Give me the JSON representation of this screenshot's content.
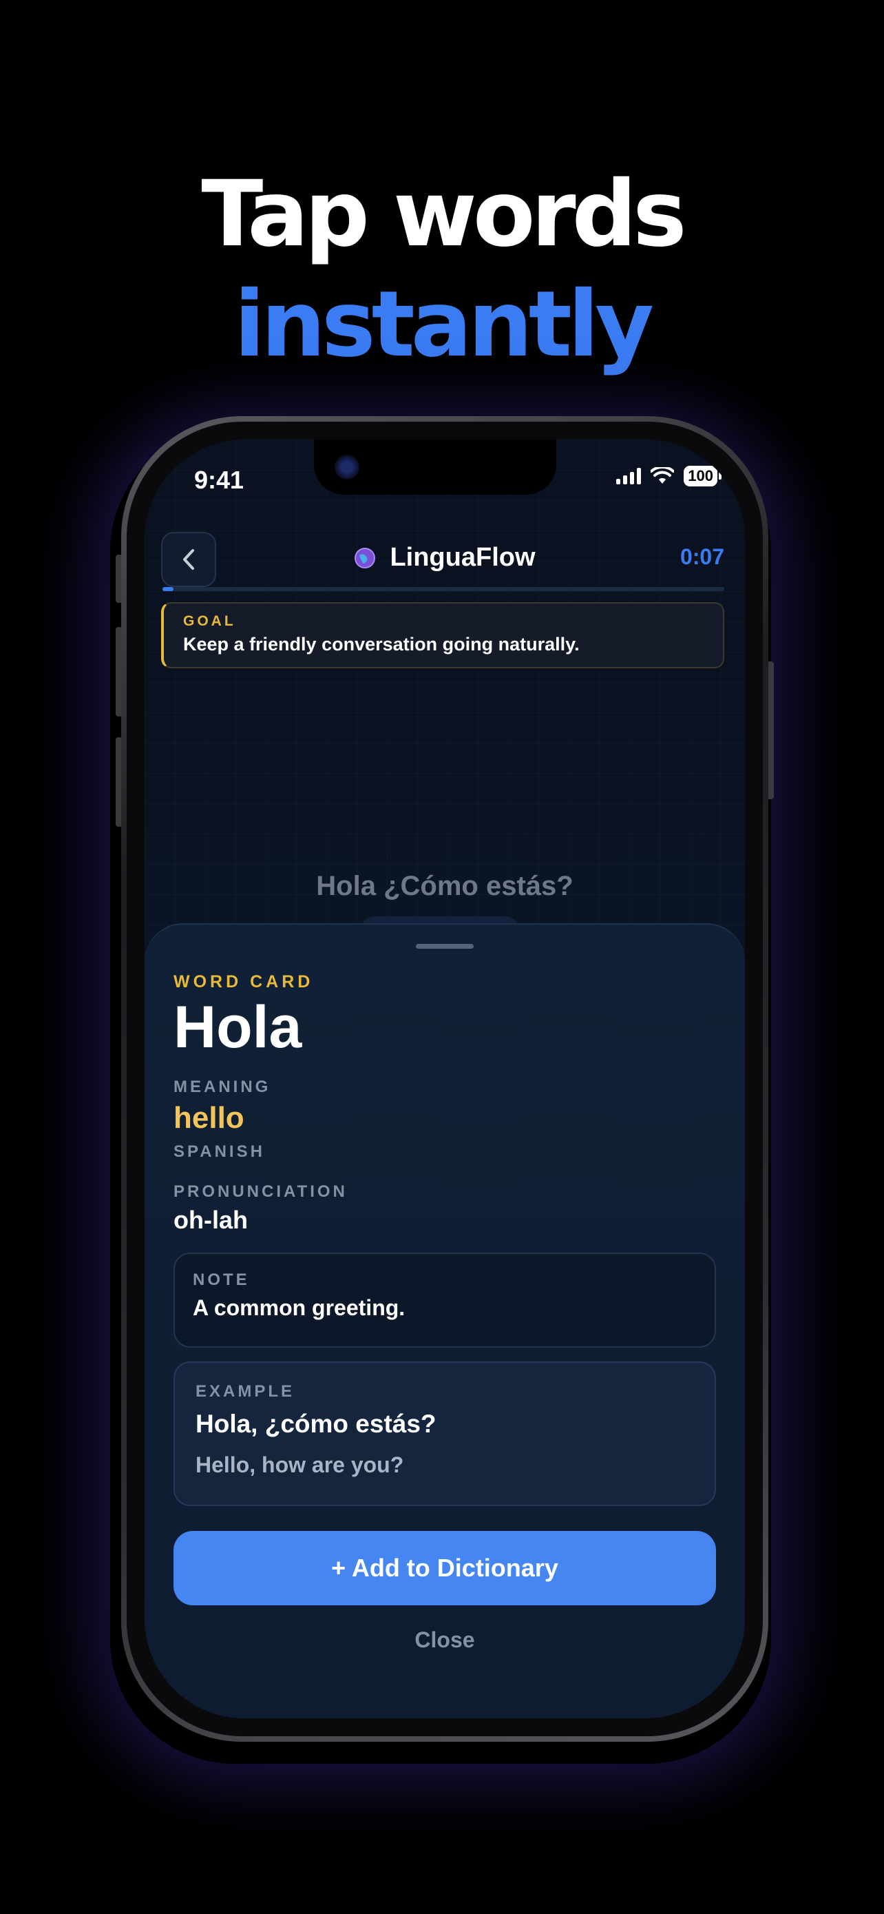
{
  "headline": {
    "line1": "Tap words",
    "line2": "instantly"
  },
  "status_bar": {
    "time": "9:41",
    "battery": "100"
  },
  "header": {
    "app_name": "LinguaFlow",
    "timer": "0:07",
    "progress": 0.02
  },
  "goal": {
    "label": "GOAL",
    "text": "Keep a friendly conversation going naturally."
  },
  "conversation": {
    "phrase": "Hola ¿Cómo estás?"
  },
  "word_card": {
    "section_label": "WORD CARD",
    "word": "Hola",
    "meaning_label": "MEANING",
    "meaning": "hello",
    "language": "SPANISH",
    "pronunciation_label": "PRONUNCIATION",
    "pronunciation": "oh-lah",
    "note_label": "NOTE",
    "note": "A common greeting.",
    "example_label": "EXAMPLE",
    "example": "Hola, ¿cómo estás?",
    "example_translation": "Hello, how are you?",
    "add_button": "+ Add to Dictionary",
    "close_button": "Close"
  },
  "colors": {
    "accent_blue": "#3b7cf2",
    "accent_gold": "#e9b93a",
    "meaning_gold": "#f2c45a"
  },
  "icons": {
    "back": "chevron-left-icon",
    "app": "globe-icon"
  }
}
